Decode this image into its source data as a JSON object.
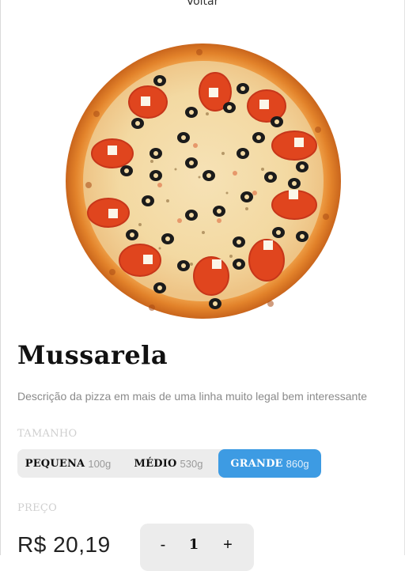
{
  "nav": {
    "back_label": "Voltar"
  },
  "product": {
    "image_icon": "pizza-image",
    "name": "Mussarela",
    "description": "Descrição da pizza em mais de uma linha muito legal bem interessante"
  },
  "size": {
    "label": "TAMANHO",
    "options": [
      {
        "name": "PEQUENA",
        "weight": "100g"
      },
      {
        "name": "MÉDIO",
        "weight": "530g"
      },
      {
        "name": "GRANDE",
        "weight": "860g"
      }
    ],
    "selected": "GRANDE"
  },
  "price": {
    "label": "PREÇO",
    "value": "R$ 20,19"
  },
  "quantity": {
    "minus_label": "-",
    "value": "1",
    "plus_label": "+"
  },
  "colors": {
    "accent": "#3d9be3",
    "selector_bg": "#ececec",
    "muted_text": "#8a8a8a"
  }
}
